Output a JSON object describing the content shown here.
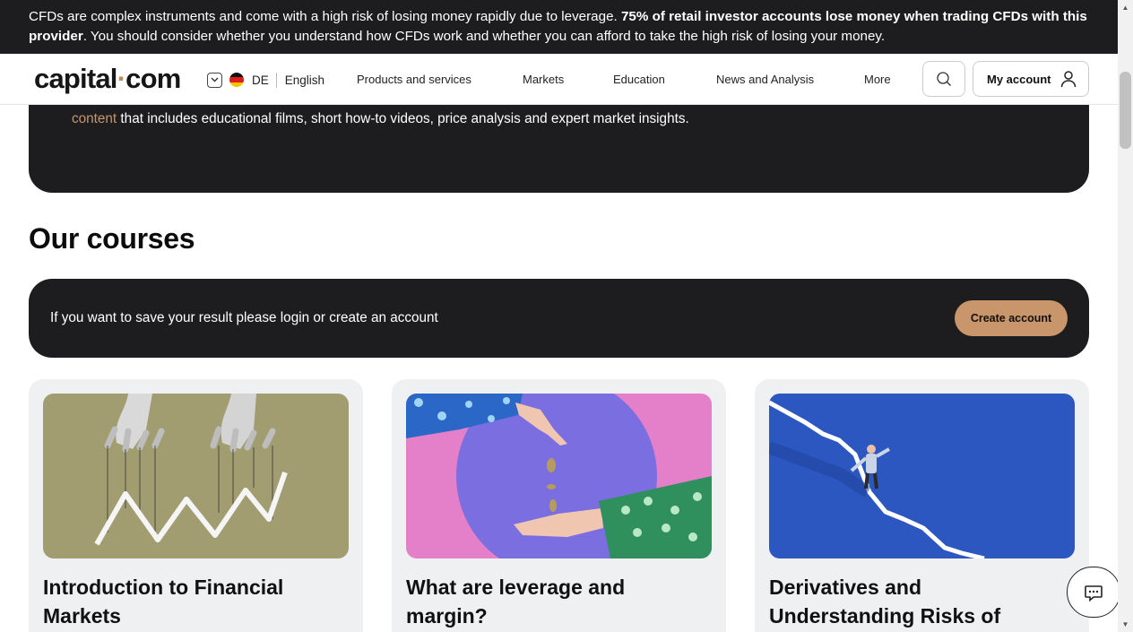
{
  "risk_banner": {
    "text_start": "CFDs are complex instruments and come with a high risk of losing money rapidly due to leverage. ",
    "text_bold": "75% of retail investor accounts lose money when trading CFDs with this provider",
    "text_end": ". You should consider whether you understand how CFDs work and whether you can afford to take the high risk of losing your money."
  },
  "header": {
    "logo_part1": "capital",
    "logo_dot": "·",
    "logo_part2": "com",
    "country_code": "DE",
    "language": "English",
    "nav": [
      "Products and services",
      "Markets",
      "Education",
      "News and Analysis",
      "More"
    ],
    "account_label": "My account"
  },
  "intro": {
    "link_text": "content",
    "text": " that includes educational films, short how-to videos, price analysis and expert market insights."
  },
  "courses": {
    "heading": "Our courses",
    "save_message": "If you want to save your result please login or create an account",
    "cta_label": "Create account",
    "cards": [
      {
        "title": "Introduction to Financial Markets"
      },
      {
        "title": "What are leverage and margin?"
      },
      {
        "title": "Derivatives and Understanding Risks of"
      }
    ]
  },
  "colors": {
    "accent": "#c9956a",
    "dark": "#1d1d1f",
    "card_bg": "#eff0f2"
  },
  "icons": [
    "chevron-down-icon",
    "germany-flag-icon",
    "search-icon",
    "user-icon",
    "chat-icon"
  ]
}
